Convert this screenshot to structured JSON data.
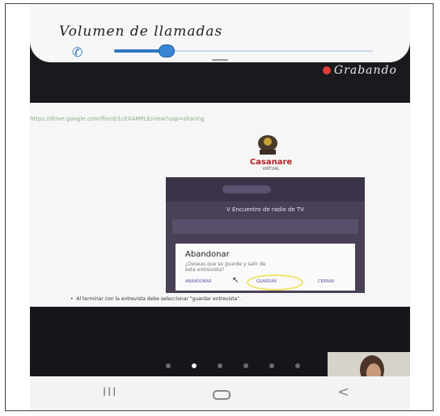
{
  "volume_panel": {
    "title": "Volumen de llamadas",
    "icon": "phone-icon",
    "level_fraction": 0.2
  },
  "recording": {
    "label": "Grabando",
    "icon": "record-dot-icon"
  },
  "page": {
    "url_text": "https://drive.google.com/file/d/1cEXAMPLE/view?usp=sharing",
    "logo_text": "Casanare",
    "logo_subtext": "VIRTUAL"
  },
  "embedded_screenshot": {
    "header_title": "V Encuentro de radio de TV",
    "dialog_title": "Abandonar",
    "dialog_text": "¿Deseas que se guarde y salir de esta entrevista?",
    "dialog_buttons": [
      "ABANDONAR",
      "GUARDAR",
      "CERRAR"
    ]
  },
  "instruction": "Al terminar con la entrevista debe seleccionar \"guardar entrevista\".",
  "carousel": {
    "total_dots": 6,
    "active_index": 1
  },
  "navbar": {
    "recent_label": "III",
    "back_label": "<"
  }
}
